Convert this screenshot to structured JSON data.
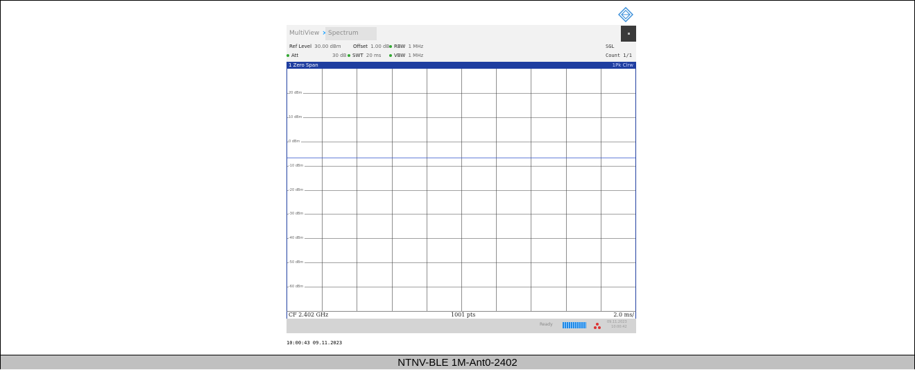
{
  "tabs": {
    "multiview": "MultiView",
    "multiview_close": "×",
    "spectrum": "Spectrum"
  },
  "params": {
    "ref_level_label": "Ref Level",
    "ref_level_value": "30.00 dBm",
    "offset_label": "Offset",
    "offset_value": "1.00 dB",
    "rbw_label": "RBW",
    "rbw_value": "1 MHz",
    "att_label": "Att",
    "att_value": "30 dB",
    "swt_label": "SWT",
    "swt_value": "20 ms",
    "vbw_label": "VBW",
    "vbw_value": "1 MHz",
    "mode": "SGL",
    "count": "Count 1/1"
  },
  "trace": {
    "window_label": "1 Zero Span",
    "trace_label": "1Pk Clrw"
  },
  "y_axis_labels": [
    "20 dBm",
    "10 dBm",
    "0 dBm",
    "-10 dBm",
    "-20 dBm",
    "-30 dBm",
    "-40 dBm",
    "-50 dBm",
    "-60 dBm"
  ],
  "footer": {
    "center_freq": "CF 2.402 GHz",
    "points": "1001 pts",
    "time_div": "2.0 ms/"
  },
  "status": {
    "ready": "Ready",
    "date": "09.11.2023",
    "time": "10:00:42"
  },
  "timestamp": "10:00:43  09.11.2023",
  "caption": "NTNV-BLE  1M-Ant0-2402",
  "colors": {
    "accent": "#1f3ea0",
    "grid": "#444444",
    "trace": "#3355cc",
    "progress": "#1e88e5"
  }
}
